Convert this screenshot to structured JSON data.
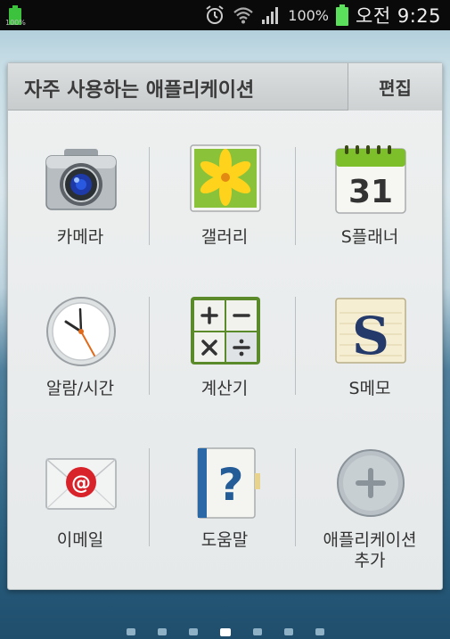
{
  "status_bar": {
    "battery_small_label": "100%",
    "battery_percent": "100%",
    "time": "오전 9:25",
    "icons": [
      "alarm-icon",
      "wifi-icon",
      "signal-icon",
      "battery-icon"
    ]
  },
  "panel": {
    "title": "자주 사용하는 애플리케이션",
    "edit_label": "편집",
    "apps": [
      {
        "label": "카메라",
        "icon": "camera-icon"
      },
      {
        "label": "갤러리",
        "icon": "gallery-icon"
      },
      {
        "label": "S플래너",
        "icon": "calendar-icon",
        "date": "31"
      },
      {
        "label": "알람/시간",
        "icon": "clock-icon"
      },
      {
        "label": "계산기",
        "icon": "calculator-icon"
      },
      {
        "label": "S메모",
        "icon": "memo-icon"
      },
      {
        "label": "이메일",
        "icon": "email-icon"
      },
      {
        "label": "도움말",
        "icon": "help-icon"
      },
      {
        "label": "애플리케이션\n추가",
        "label_line1": "애플리케이션",
        "label_line2": "추가",
        "icon": "add-app-icon"
      }
    ]
  },
  "page_indicator": {
    "count": 7,
    "active_index": 3
  },
  "colors": {
    "status_bar_bg": "#0a0a0a",
    "battery_green": "#5ae05a",
    "panel_bg": "#eef0f0",
    "text": "#333333"
  }
}
